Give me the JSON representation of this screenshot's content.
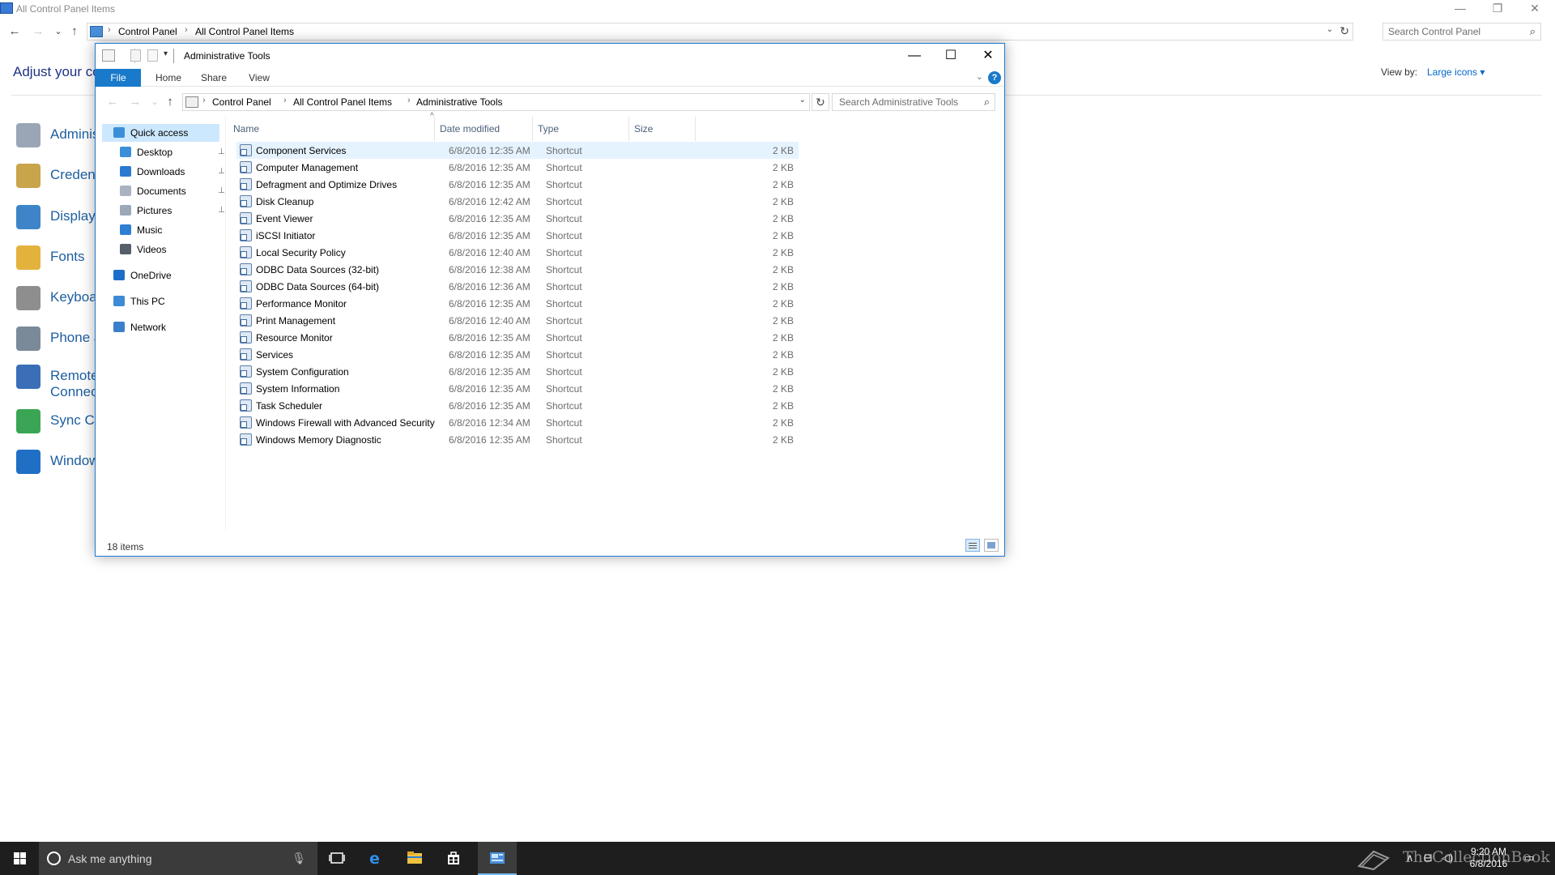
{
  "bg_window": {
    "title": "All Control Panel Items",
    "caption": {
      "minimize": "—",
      "restore": "❐",
      "close": "✕"
    },
    "nav": {
      "back": "←",
      "forward": "→",
      "recent": "⌄",
      "up": "↑"
    },
    "breadcrumb": [
      "Control Panel",
      "All Control Panel Items"
    ],
    "search_placeholder": "Search Control Panel",
    "heading": "Adjust your co",
    "view_by_label": "View by:",
    "view_by_value": "Large icons ▾",
    "items": [
      {
        "label": "Adminis",
        "icon": "administrative-tools-icon",
        "color": "#9aa6b5"
      },
      {
        "label": "Credent",
        "icon": "credential-manager-icon",
        "color": "#c8a44a"
      },
      {
        "label": "Display",
        "icon": "display-icon",
        "color": "#3d84c8"
      },
      {
        "label": "Fonts",
        "icon": "fonts-icon",
        "color": "#e3b23c"
      },
      {
        "label": "Keyboar",
        "icon": "keyboard-icon",
        "color": "#8e8e8e"
      },
      {
        "label": "Phone a",
        "icon": "phone-modem-icon",
        "color": "#7b8a99"
      },
      {
        "label": "Remote",
        "label2": "Connect",
        "icon": "remoteapp-icon",
        "color": "#3a6fb8"
      },
      {
        "label": "Sync Ce",
        "icon": "sync-center-icon",
        "color": "#3aa655"
      },
      {
        "label": "Window",
        "icon": "windows-defender-icon",
        "color": "#1f6fc5"
      }
    ]
  },
  "explorer": {
    "title": "Administrative Tools",
    "caption": {
      "minimize": "—",
      "maximize": "☐",
      "close": "✕"
    },
    "ribbon_tabs": [
      "File",
      "Home",
      "Share",
      "View"
    ],
    "help": "?",
    "collapse": "⌄",
    "nav": {
      "back": "←",
      "forward": "→",
      "recent": "⌄",
      "up": "↑",
      "refresh": "↻"
    },
    "breadcrumb": [
      "Control Panel",
      "All Control Panel Items",
      "Administrative Tools"
    ],
    "search_placeholder": "Search Administrative Tools",
    "nav_pane": [
      {
        "label": "Quick access",
        "icon": "star-icon",
        "color": "#3b8fd8",
        "level": 0,
        "selected": true,
        "pinned": false
      },
      {
        "label": "Desktop",
        "icon": "desktop-icon",
        "color": "#3b8fd8",
        "level": 1,
        "selected": false,
        "pinned": true
      },
      {
        "label": "Downloads",
        "icon": "downloads-icon",
        "color": "#2a7ad0",
        "level": 1,
        "selected": false,
        "pinned": true
      },
      {
        "label": "Documents",
        "icon": "documents-icon",
        "color": "#aab2bf",
        "level": 1,
        "selected": false,
        "pinned": true
      },
      {
        "label": "Pictures",
        "icon": "pictures-icon",
        "color": "#9aa8b8",
        "level": 1,
        "selected": false,
        "pinned": true
      },
      {
        "label": "Music",
        "icon": "music-icon",
        "color": "#2f7fd3",
        "level": 1,
        "selected": false,
        "pinned": false
      },
      {
        "label": "Videos",
        "icon": "videos-icon",
        "color": "#555e69",
        "level": 1,
        "selected": false,
        "pinned": false
      },
      {
        "label": "OneDrive",
        "icon": "onedrive-icon",
        "color": "#1c6fc9",
        "level": 0,
        "selected": false,
        "pinned": false
      },
      {
        "label": "This PC",
        "icon": "this-pc-icon",
        "color": "#3d8ad5",
        "level": 0,
        "selected": false,
        "pinned": false
      },
      {
        "label": "Network",
        "icon": "network-icon",
        "color": "#3c7fcd",
        "level": 0,
        "selected": false,
        "pinned": false
      }
    ],
    "columns": [
      "Name",
      "Date modified",
      "Type",
      "Size"
    ],
    "sort_arrow": "^",
    "rows": [
      {
        "name": "Component Services",
        "date": "6/8/2016 12:35 AM",
        "type": "Shortcut",
        "size": "2 KB",
        "selected": true
      },
      {
        "name": "Computer Management",
        "date": "6/8/2016 12:35 AM",
        "type": "Shortcut",
        "size": "2 KB"
      },
      {
        "name": "Defragment and Optimize Drives",
        "date": "6/8/2016 12:35 AM",
        "type": "Shortcut",
        "size": "2 KB"
      },
      {
        "name": "Disk Cleanup",
        "date": "6/8/2016 12:42 AM",
        "type": "Shortcut",
        "size": "2 KB"
      },
      {
        "name": "Event Viewer",
        "date": "6/8/2016 12:35 AM",
        "type": "Shortcut",
        "size": "2 KB"
      },
      {
        "name": "iSCSI Initiator",
        "date": "6/8/2016 12:35 AM",
        "type": "Shortcut",
        "size": "2 KB"
      },
      {
        "name": "Local Security Policy",
        "date": "6/8/2016 12:40 AM",
        "type": "Shortcut",
        "size": "2 KB"
      },
      {
        "name": "ODBC Data Sources (32-bit)",
        "date": "6/8/2016 12:38 AM",
        "type": "Shortcut",
        "size": "2 KB"
      },
      {
        "name": "ODBC Data Sources (64-bit)",
        "date": "6/8/2016 12:36 AM",
        "type": "Shortcut",
        "size": "2 KB"
      },
      {
        "name": "Performance Monitor",
        "date": "6/8/2016 12:35 AM",
        "type": "Shortcut",
        "size": "2 KB"
      },
      {
        "name": "Print Management",
        "date": "6/8/2016 12:40 AM",
        "type": "Shortcut",
        "size": "2 KB"
      },
      {
        "name": "Resource Monitor",
        "date": "6/8/2016 12:35 AM",
        "type": "Shortcut",
        "size": "2 KB"
      },
      {
        "name": "Services",
        "date": "6/8/2016 12:35 AM",
        "type": "Shortcut",
        "size": "2 KB"
      },
      {
        "name": "System Configuration",
        "date": "6/8/2016 12:35 AM",
        "type": "Shortcut",
        "size": "2 KB"
      },
      {
        "name": "System Information",
        "date": "6/8/2016 12:35 AM",
        "type": "Shortcut",
        "size": "2 KB"
      },
      {
        "name": "Task Scheduler",
        "date": "6/8/2016 12:35 AM",
        "type": "Shortcut",
        "size": "2 KB"
      },
      {
        "name": "Windows Firewall with Advanced Security",
        "date": "6/8/2016 12:34 AM",
        "type": "Shortcut",
        "size": "2 KB"
      },
      {
        "name": "Windows Memory Diagnostic",
        "date": "6/8/2016 12:35 AM",
        "type": "Shortcut",
        "size": "2 KB"
      }
    ],
    "status_text": "18 items"
  },
  "taskbar": {
    "search_placeholder": "Ask me anything",
    "mic": "🎙",
    "clock_time": "9:20 AM",
    "clock_date": "6/8/2016",
    "watermark": "TheCollectionBook",
    "tray": {
      "chevron": "∧",
      "network": "⊟",
      "volume": "◁)",
      "notifications": "▭"
    },
    "colors": {
      "accent": "#76b9ed",
      "bar": "#1e1e1e",
      "search": "#3b3b3b"
    }
  },
  "colors": {
    "explorer_border": "#1b7ad6",
    "file_tab": "#1979ca",
    "nav_selected": "#cce8ff",
    "row_selected": "#e5f3ff",
    "cp_link": "#1e5fa0"
  }
}
